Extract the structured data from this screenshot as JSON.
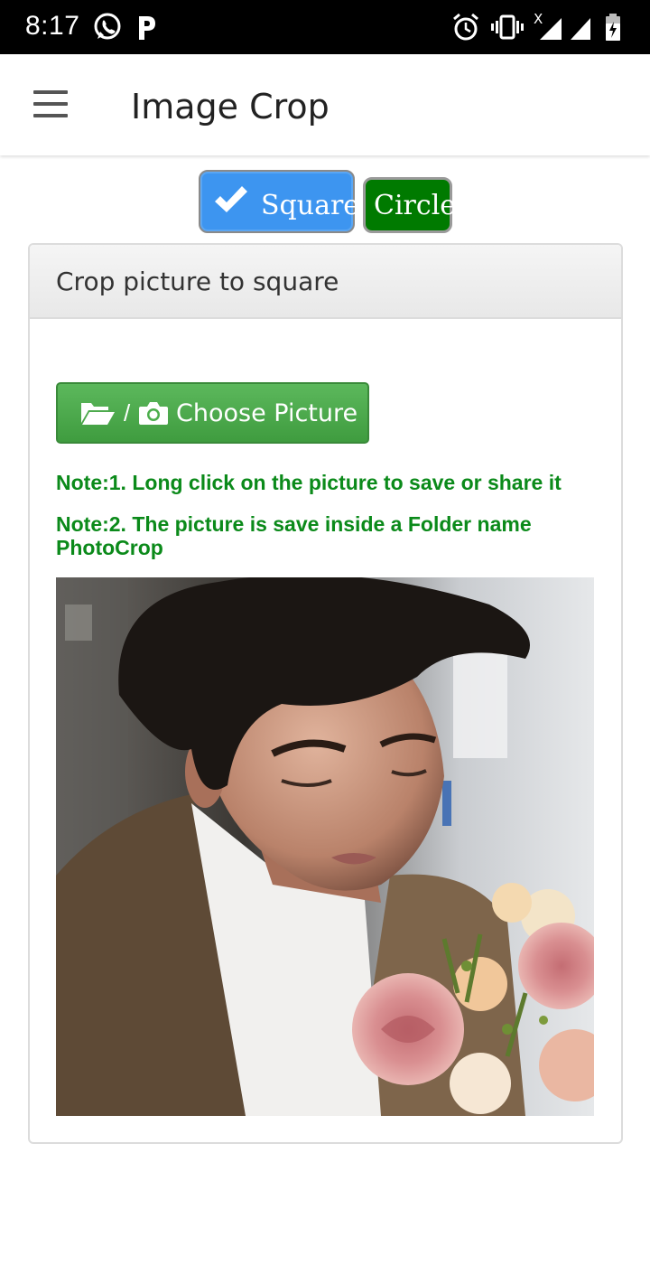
{
  "status_bar": {
    "time": "8:17",
    "notification_icons": [
      "whatsapp-icon",
      "parking-p-icon"
    ],
    "system_icons": [
      "alarm-icon",
      "vibrate-icon",
      "signal-x-icon",
      "signal-icon",
      "battery-charging-icon"
    ]
  },
  "app_bar": {
    "menu_icon": "hamburger-menu-icon",
    "title": "Image Crop"
  },
  "shape_toggle": {
    "square_label": "Square",
    "square_selected": true,
    "circle_label": "Circle",
    "colors": {
      "square_bg": "#3d95f0",
      "circle_bg": "#007a00"
    }
  },
  "panel": {
    "heading": "Crop picture to square",
    "choose_button": {
      "separator": "/",
      "label": "Choose Picture",
      "icons": [
        "folder-open-icon",
        "camera-icon"
      ],
      "color": "#4cae4c"
    },
    "notes": [
      "Note:1. Long click on the picture to save or share it",
      "Note:2. The picture is save inside a Folder name PhotoCrop"
    ],
    "note_color": "#0b8a1a"
  }
}
